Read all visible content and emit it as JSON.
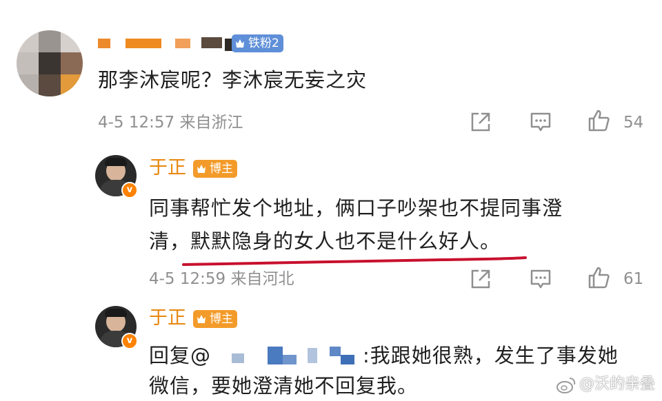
{
  "colors": {
    "accent": "#e8860c",
    "meta": "#8f8f8f",
    "underline": "#c8102e",
    "fan_badge": "#5f8fd8",
    "blogger_badge": "#f39b2a"
  },
  "comment1": {
    "fan_badge": "铁粉2",
    "text": "那李沐宸呢？李沐宸无妄之灾",
    "meta": "4-5 12:57 来自浙江",
    "like_count": "54"
  },
  "reply1": {
    "author": "于正",
    "badge": "博主",
    "line1": "同事帮忙发个地址，俩口子吵架也不提同事澄",
    "line2_prefix": "清，",
    "line2_underlined": "默默隐身的女人也不是什么好人。",
    "meta": "4-5 12:59 来自河北",
    "like_count": "61"
  },
  "reply2": {
    "author": "于正",
    "badge": "博主",
    "line1_prefix": "回复@",
    "line1_suffix": ":我跟她很熟，发生了事发她",
    "line2": "微信，要她澄清她不回复我。"
  },
  "watermark": "@沃的亲叠",
  "icons": [
    "share-icon",
    "comment-icon",
    "like-icon",
    "verified-icon",
    "crown-icon",
    "weibo-logo-icon"
  ]
}
